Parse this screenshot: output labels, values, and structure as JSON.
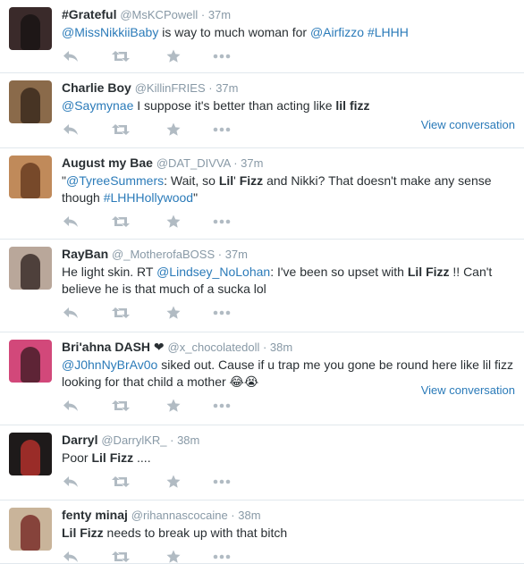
{
  "tweets": [
    {
      "fullname": "#Grateful",
      "username": "@MsKCPowell",
      "time": "37m",
      "avatar_color": "#3a2a2a",
      "avatar_accent": "#1a1414",
      "text": [
        {
          "t": "@MissNikkiiBaby",
          "k": "mention"
        },
        {
          "t": " is way to much woman for ",
          "k": "plain"
        },
        {
          "t": "@Airfizzo",
          "k": "mention"
        },
        {
          "t": " ",
          "k": "plain"
        },
        {
          "t": "#LHHH",
          "k": "hashtag"
        }
      ],
      "view_conversation": ""
    },
    {
      "fullname": "Charlie Boy",
      "username": "@KillinFRIES",
      "time": "37m",
      "avatar_color": "#8a6a4a",
      "avatar_accent": "#3b2a1d",
      "text": [
        {
          "t": "@Saymynae",
          "k": "mention"
        },
        {
          "t": " I suppose it's better than acting like ",
          "k": "plain"
        },
        {
          "t": "lil fizz",
          "k": "bold"
        }
      ],
      "view_conversation": "View conversation"
    },
    {
      "fullname": "August my Bae",
      "username": "@DAT_DIVVA",
      "time": "37m",
      "avatar_color": "#c08a5a",
      "avatar_accent": "#6a3d22",
      "text": [
        {
          "t": "\"",
          "k": "plain"
        },
        {
          "t": "@TyreeSummers",
          "k": "mention"
        },
        {
          "t": ": Wait, so ",
          "k": "plain"
        },
        {
          "t": "Lil",
          "k": "bold"
        },
        {
          "t": "' ",
          "k": "plain"
        },
        {
          "t": "Fizz",
          "k": "bold"
        },
        {
          "t": " and Nikki? That doesn't make any sense though ",
          "k": "plain"
        },
        {
          "t": "#LHHHollywood",
          "k": "hashtag"
        },
        {
          "t": "\"",
          "k": "plain"
        }
      ],
      "view_conversation": ""
    },
    {
      "fullname": "RayBan",
      "username": "@_MotherofaBOSS",
      "time": "37m",
      "avatar_color": "#b9a79a",
      "avatar_accent": "#3b2e2a",
      "text": [
        {
          "t": "He light skin. RT ",
          "k": "plain"
        },
        {
          "t": "@Lindsey_NoLohan",
          "k": "mention"
        },
        {
          "t": ": I've been so upset with ",
          "k": "plain"
        },
        {
          "t": "Lil Fizz",
          "k": "bold"
        },
        {
          "t": " !! Can't believe he is that much of a sucka lol",
          "k": "plain"
        }
      ],
      "view_conversation": ""
    },
    {
      "fullname": "Bri'ahna DASH ❤",
      "username": "@x_chocolatedoll",
      "time": "38m",
      "avatar_color": "#d2487a",
      "avatar_accent": "#4a1f2a",
      "text": [
        {
          "t": "@J0hnNyBrAv0o",
          "k": "mention"
        },
        {
          "t": " siked out. Cause if u trap me you gone be round here like lil fizz looking for that child a mother 😂😭",
          "k": "plain"
        }
      ],
      "view_conversation": "View conversation"
    },
    {
      "fullname": "Darryl",
      "username": "@DarrylKR_",
      "time": "38m",
      "avatar_color": "#1e1a1a",
      "avatar_accent": "#b0302c",
      "text": [
        {
          "t": "Poor ",
          "k": "plain"
        },
        {
          "t": "Lil Fizz",
          "k": "bold"
        },
        {
          "t": " ....",
          "k": "plain"
        }
      ],
      "view_conversation": ""
    },
    {
      "fullname": "fenty  minaj",
      "username": "@rihannascocaine",
      "time": "38m",
      "avatar_color": "#c9b49a",
      "avatar_accent": "#7a2f2a",
      "text": [
        {
          "t": "Lil Fizz",
          "k": "bold"
        },
        {
          "t": " needs to break up with that bitch",
          "k": "plain"
        }
      ],
      "view_conversation": ""
    }
  ],
  "icons": {
    "reply": "reply-icon",
    "retweet": "retweet-icon",
    "favorite": "star-icon",
    "more": "more-dots-icon"
  },
  "colors": {
    "link": "#2b7bb9",
    "secondary": "#8899a6",
    "action_icon": "#b1bbc3",
    "divider": "#e1e8ed"
  }
}
